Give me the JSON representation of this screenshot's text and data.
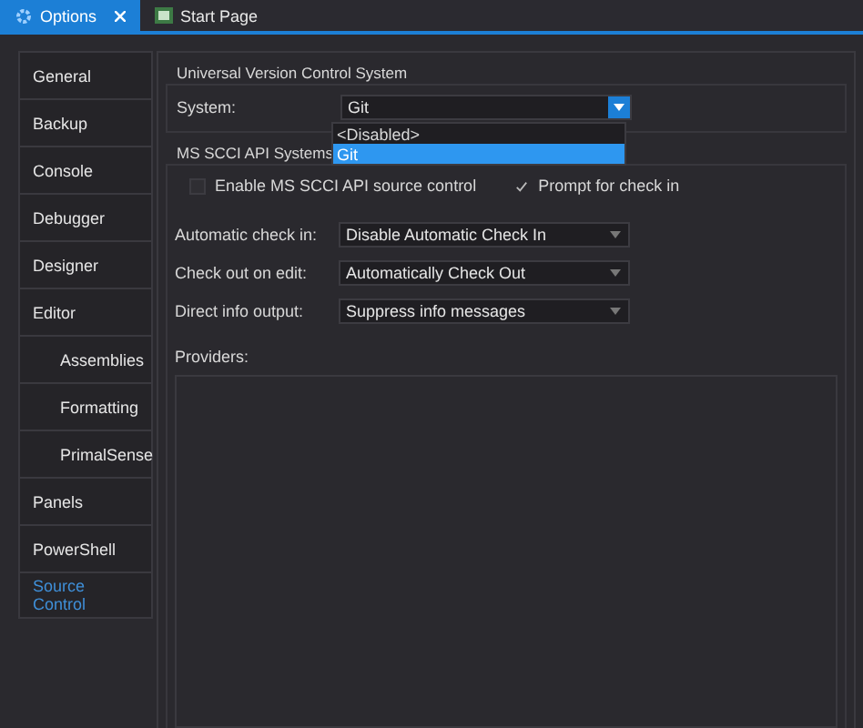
{
  "tabs": [
    {
      "label": "Options",
      "selected": true,
      "closable": true
    },
    {
      "label": "Start Page",
      "selected": false,
      "closable": false
    }
  ],
  "sidebar": {
    "items": [
      {
        "label": "General",
        "selected": false,
        "indented": false
      },
      {
        "label": "Backup",
        "selected": false,
        "indented": false
      },
      {
        "label": "Console",
        "selected": false,
        "indented": false
      },
      {
        "label": "Debugger",
        "selected": false,
        "indented": false
      },
      {
        "label": "Designer",
        "selected": false,
        "indented": false
      },
      {
        "label": "Editor",
        "selected": false,
        "indented": false
      },
      {
        "label": "Assemblies",
        "selected": false,
        "indented": true
      },
      {
        "label": "Formatting",
        "selected": false,
        "indented": true
      },
      {
        "label": "PrimalSense",
        "selected": false,
        "indented": true
      },
      {
        "label": "Panels",
        "selected": false,
        "indented": false
      },
      {
        "label": "PowerShell",
        "selected": false,
        "indented": false
      },
      {
        "label": "Source Control",
        "selected": true,
        "indented": false
      }
    ]
  },
  "uvcs": {
    "title": "Universal Version Control System",
    "system_label": "System:",
    "system_value": "Git",
    "dropdown_open": true,
    "options": [
      {
        "label": "<Disabled>",
        "selected": false
      },
      {
        "label": "Git",
        "selected": true
      }
    ]
  },
  "scci": {
    "title": "MS SCCI API Systems",
    "checks": [
      {
        "label": "Enable MS SCCI API source control",
        "checked": false
      },
      {
        "label": "Prompt for check in",
        "checked": true
      }
    ],
    "settings": [
      {
        "label": "Automatic check in:",
        "value": "Disable Automatic Check In"
      },
      {
        "label": "Check out on edit:",
        "value": "Automatically Check Out"
      },
      {
        "label": "Direct info output:",
        "value": "Suppress info messages"
      }
    ],
    "providers_label": "Providers:"
  }
}
